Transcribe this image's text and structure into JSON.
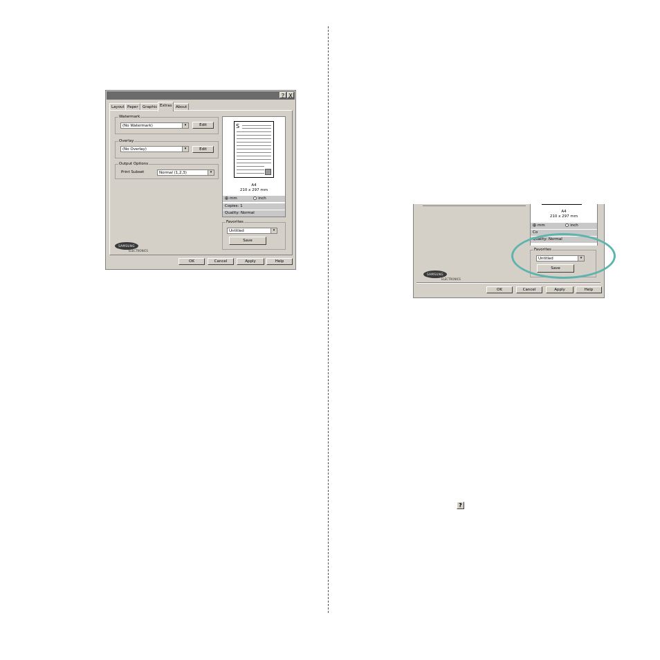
{
  "dialog1": {
    "title_buttons": [
      "?",
      "X"
    ],
    "tabs": [
      "Layout",
      "Paper",
      "Graphic",
      "Extras",
      "About"
    ],
    "active_tab": "Extras",
    "watermark": {
      "label": "Watermark",
      "value": "(No Watermark)",
      "edit_button": "Edit"
    },
    "overlay": {
      "label": "Overlay",
      "value": "(No Overlay)",
      "edit_button": "Edit"
    },
    "output_options": {
      "label": "Output Options",
      "print_subset_label": "Print Subset",
      "print_subset_value": "Normal (1,2,3)"
    },
    "preview": {
      "page_letter": "S",
      "paper_name": "A4",
      "paper_size": "210 x 297 mm",
      "unit_mm": "mm",
      "unit_inch": "inch",
      "copies": "Copies: 1",
      "quality": "Quality: Normal"
    },
    "favorites": {
      "label": "Favorites",
      "value": "Untitled",
      "save_button": "Save"
    },
    "logo": {
      "brand": "SAMSUNG",
      "sub": "ELECTRONICS"
    },
    "buttons": {
      "ok": "OK",
      "cancel": "Cancel",
      "apply": "Apply",
      "help": "Help"
    }
  },
  "dialog2": {
    "paper_name": "A4",
    "paper_size": "210 x 297 mm",
    "unit_mm": "mm",
    "unit_inch": "inch",
    "copies_partial": "Co",
    "quality": "Quality: Normal",
    "favorites": {
      "label": "Favorites",
      "value": "Untitled",
      "save_button": "Save"
    },
    "logo": {
      "brand": "SAMSUNG",
      "sub": "ELECTRONICS"
    },
    "buttons": {
      "ok": "OK",
      "cancel": "Cancel",
      "apply": "Apply",
      "help": "Help"
    }
  },
  "help_icon_glyph": "?",
  "colors": {
    "dialog_bg": "#d4d0c8",
    "highlight_ellipse": "#5fb3ad",
    "titlebar": "#6b6b6b"
  }
}
